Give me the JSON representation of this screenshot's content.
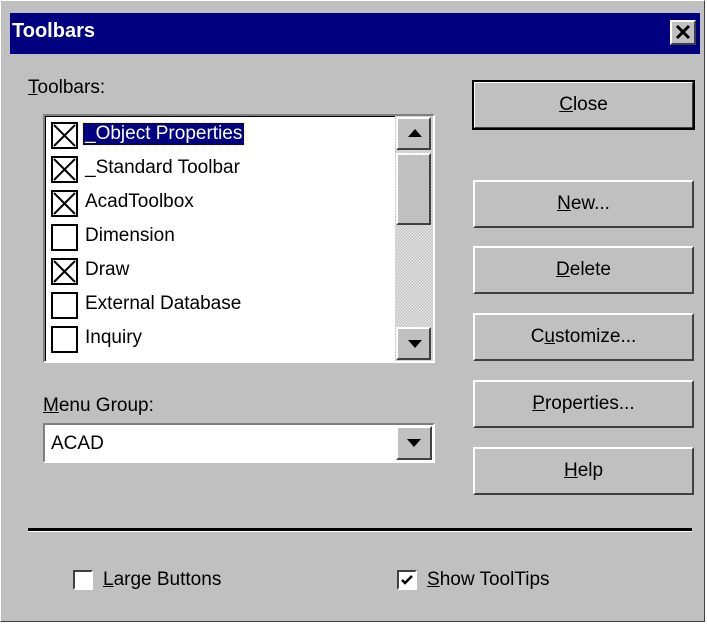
{
  "window": {
    "title": "Toolbars",
    "close_glyph": "✕"
  },
  "toolbars_label": {
    "accel": "T",
    "rest": "oolbars:"
  },
  "toolbars_list": [
    {
      "label": "_Object Properties",
      "checked": true,
      "selected": true
    },
    {
      "label": "_Standard Toolbar",
      "checked": true,
      "selected": false
    },
    {
      "label": "AcadToolbox",
      "checked": true,
      "selected": false
    },
    {
      "label": "Dimension",
      "checked": false,
      "selected": false
    },
    {
      "label": "Draw",
      "checked": true,
      "selected": false
    },
    {
      "label": "External Database",
      "checked": false,
      "selected": false
    },
    {
      "label": "Inquiry",
      "checked": false,
      "selected": false
    }
  ],
  "menu_group": {
    "label_accel": "M",
    "label_rest": "enu Group:",
    "value": "ACAD"
  },
  "buttons": {
    "close": {
      "accel": "C",
      "rest": "lose"
    },
    "new": {
      "accel": "N",
      "rest": "ew..."
    },
    "delete": {
      "accel": "D",
      "rest": "elete"
    },
    "customize": {
      "pre": "C",
      "accel": "u",
      "rest": "stomize..."
    },
    "properties": {
      "accel": "P",
      "rest": "roperties..."
    },
    "help": {
      "accel": "H",
      "rest": "elp"
    }
  },
  "options": {
    "large_buttons": {
      "accel": "L",
      "rest": "arge Buttons",
      "checked": false
    },
    "show_tooltips": {
      "accel": "S",
      "rest": "how ToolTips",
      "checked": true
    }
  },
  "colors": {
    "face": "#c0c0c0",
    "titlebar": "#000080",
    "selection": "#000080"
  }
}
